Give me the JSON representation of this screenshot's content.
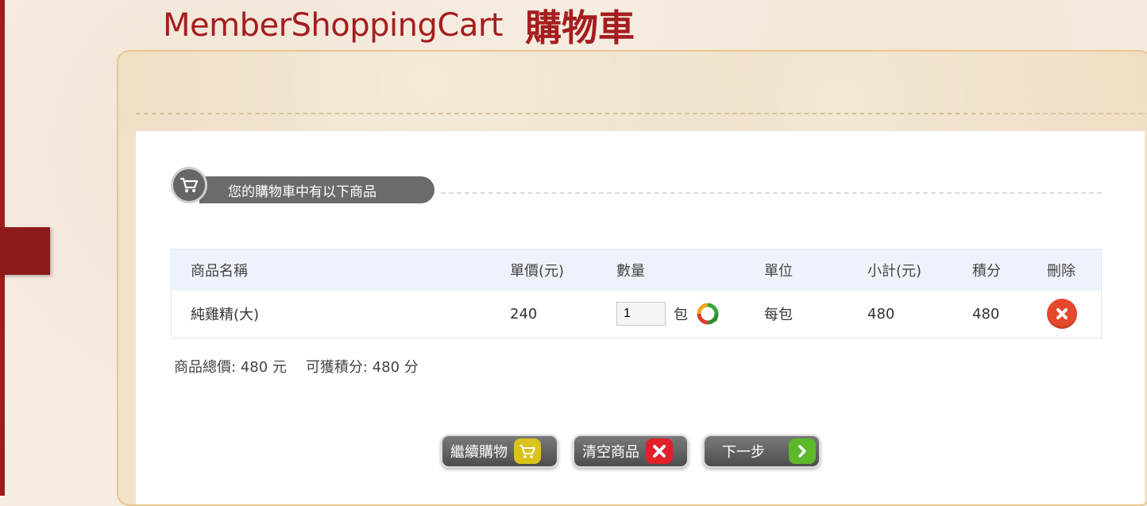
{
  "brand": {
    "title_en": "MemberShoppingCart",
    "title_zh": "購物車"
  },
  "section": {
    "header": "您的購物車中有以下商品"
  },
  "table": {
    "headers": [
      "商品名稱",
      "單價(元)",
      "數量",
      "單位",
      "小計(元)",
      "積分",
      "刪除"
    ],
    "rows": [
      {
        "name": "純雞精(大)",
        "price": "240",
        "qty": "1",
        "qty_unit": "包",
        "unit": "每包",
        "subtotal": "480",
        "points": "480"
      }
    ]
  },
  "totals": {
    "total_text": "商品總價: 480 元",
    "points_text": "可獲積分: 480 分"
  },
  "buttons": {
    "continue": "繼續購物",
    "clear": "清空商品",
    "next": "下一步"
  },
  "colors": {
    "brand_red": "#a51d1f",
    "delete_orange": "#e4492c",
    "continue_yellow": "#d9c31c",
    "clear_red": "#e0202a",
    "next_green": "#5db82a"
  },
  "icons": {
    "cart": "cart-icon",
    "refresh": "refresh-icon",
    "delete": "delete-icon",
    "arrow": "arrow-right-icon"
  }
}
